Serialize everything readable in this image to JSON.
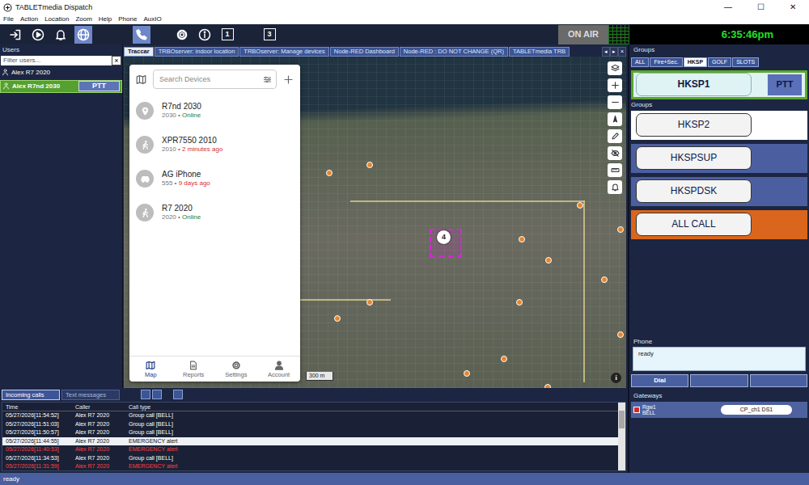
{
  "window": {
    "title": "TABLETmedia Dispatch",
    "controls": [
      "—",
      "☐",
      "✕"
    ]
  },
  "menu": [
    "File",
    "Action",
    "Location",
    "Zoom",
    "Help",
    "Phone",
    "AuxIO"
  ],
  "toolbar": {
    "buttons": [
      {
        "kind": "login",
        "selected": false
      },
      {
        "kind": "play",
        "selected": false
      },
      {
        "kind": "bell",
        "selected": false
      },
      {
        "kind": "globe",
        "selected": true
      },
      {
        "kind": "phone",
        "selected": true
      },
      {
        "kind": "gear",
        "selected": false
      },
      {
        "kind": "info",
        "selected": false
      },
      {
        "kind": "box",
        "label": "1",
        "selected": false
      },
      {
        "kind": "box",
        "label": "3",
        "selected": false
      }
    ],
    "on_air": "ON AIR",
    "clock": "6:35:46pm"
  },
  "users": {
    "title": "Users",
    "filter_placeholder": "Filter users...",
    "clear": "×",
    "items": [
      {
        "name": "Alex R7 2020",
        "selected": false
      },
      {
        "name": "Alex R7nd 2030",
        "selected": true,
        "ptt": "PTT"
      }
    ]
  },
  "center_tabs": {
    "items": [
      {
        "label": "Traccar",
        "selected": true
      },
      {
        "label": "TRBOserver: indoor location",
        "selected": false
      },
      {
        "label": "TRBOserver: Manage devices",
        "selected": false
      },
      {
        "label": "Node-RED Dashboard",
        "selected": false
      },
      {
        "label": "Node-RED : DO NOT CHANGE (QR)",
        "selected": false
      },
      {
        "label": "TABLETmedia TRB",
        "selected": false
      }
    ],
    "nav": [
      "◂",
      "▸",
      "×"
    ]
  },
  "traccar": {
    "search_placeholder": "Search Devices",
    "separator": "•",
    "devices": [
      {
        "name": "R7nd 2030",
        "id": "2030",
        "status": "Online",
        "online": true,
        "kind": "pin"
      },
      {
        "name": "XPR7550 2010",
        "id": "2010",
        "status": "2 minutes ago",
        "online": false,
        "kind": "walk"
      },
      {
        "name": "AG iPhone",
        "id": "555",
        "status": "9 days ago",
        "online": false,
        "kind": "car"
      },
      {
        "name": "R7 2020",
        "id": "2020",
        "status": "Online",
        "online": true,
        "kind": "walk"
      }
    ],
    "nav": [
      {
        "label": "Map",
        "kind": "map",
        "selected": true
      },
      {
        "label": "Reports",
        "kind": "reports",
        "selected": false
      },
      {
        "label": "Settings",
        "kind": "settings",
        "selected": false
      },
      {
        "label": "Account",
        "kind": "account",
        "selected": false
      }
    ],
    "cluster": "4",
    "scale": "300 m",
    "map_info": "i"
  },
  "groups": {
    "title": "Groups",
    "tabs": [
      {
        "label": "ALL",
        "selected": false
      },
      {
        "label": "Fire+Sec.",
        "selected": false
      },
      {
        "label": "HKSP",
        "selected": true
      },
      {
        "label": "GOLF",
        "selected": false
      },
      {
        "label": "SLOTS",
        "selected": false
      }
    ],
    "caption": "Groups",
    "items": [
      {
        "label": "HKSP1",
        "selected": true,
        "ptt": "PTT",
        "color": "#5aa82c"
      },
      {
        "label": "HKSP2",
        "selected": false,
        "color": "#ffffff"
      },
      {
        "label": "HKSPSUP",
        "selected": false,
        "color": "#4b5fa0"
      },
      {
        "label": "HKSPDSK",
        "selected": false,
        "color": "#4b5fa0"
      },
      {
        "label": "ALL CALL",
        "selected": false,
        "color": "#d9661c"
      }
    ]
  },
  "phone": {
    "title": "Phone",
    "display": "ready",
    "buttons": [
      "Dial",
      "",
      ""
    ]
  },
  "gateways": {
    "title": "Gateways",
    "items": [
      {
        "name": "Rgw1",
        "sub": "BELL",
        "channel": "CP_ch1 DS1"
      }
    ]
  },
  "calls": {
    "tabs": [
      {
        "label": "Incoming calls",
        "selected": true
      },
      {
        "label": "Text messages",
        "selected": false
      }
    ],
    "columns": [
      "Time",
      "Caller",
      "Call type"
    ],
    "rows": [
      {
        "cells": [
          "05/27/2026[11:54:52]",
          "Alex R7 2020",
          "Group call [BELL]"
        ],
        "emergency": false,
        "selected": false
      },
      {
        "cells": [
          "05/27/2026[11:51:03]",
          "Alex R7 2020",
          "Group call [BELL]"
        ],
        "emergency": false,
        "selected": false
      },
      {
        "cells": [
          "05/27/2026[11:50:57]",
          "Alex R7 2020",
          "Group call [BELL]"
        ],
        "emergency": false,
        "selected": false
      },
      {
        "cells": [
          "05/27/2026[11:44:55]",
          "Alex R7 2020",
          "EMERGENCY alert"
        ],
        "emergency": true,
        "selected": true
      },
      {
        "cells": [
          "05/27/2026[11:40:53]",
          "Alex R7 2020",
          "EMERGENCY alert"
        ],
        "emergency": true,
        "selected": false
      },
      {
        "cells": [
          "05/27/2026[11:34:53]",
          "Alex R7 2020",
          "Group call [BELL]"
        ],
        "emergency": false,
        "selected": false
      },
      {
        "cells": [
          "05/27/2026[11:31:59]",
          "Alex R7 2020",
          "EMERGENCY alert"
        ],
        "emergency": true,
        "selected": false
      }
    ]
  },
  "status_bar": "ready"
}
